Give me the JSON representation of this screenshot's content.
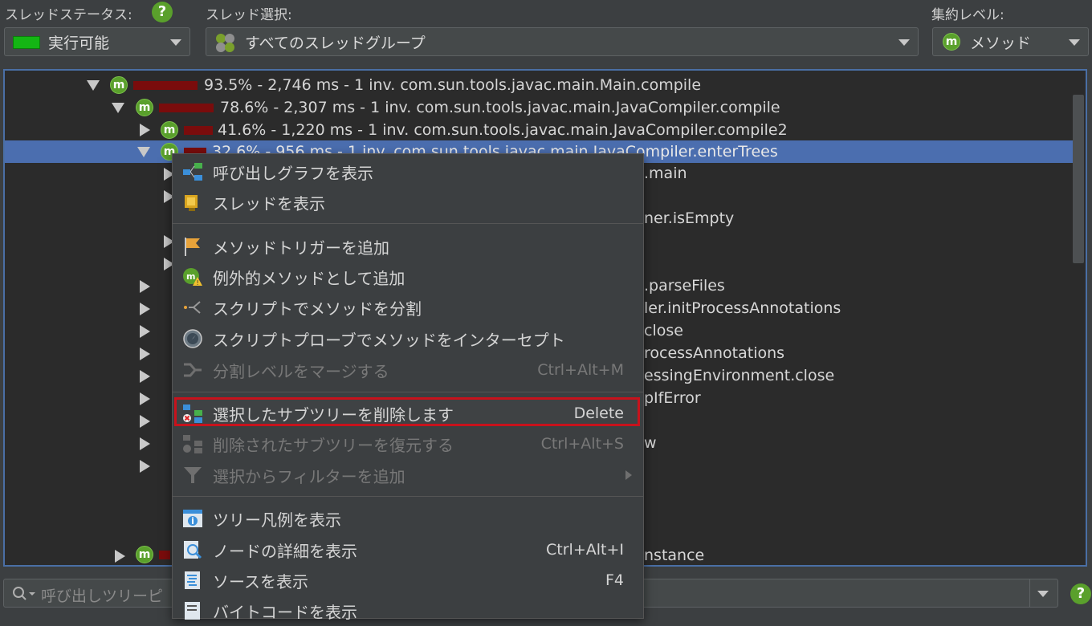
{
  "toolbar": {
    "thread_status_label": "スレッドステータス:",
    "thread_status_value": "実行可能",
    "thread_select_label": "スレッド選択:",
    "thread_select_value": "すべてのスレッドグループ",
    "aggregation_label": "集約レベル:",
    "aggregation_value": "メソッド",
    "help": "?",
    "status_color": "#14b514"
  },
  "tree": {
    "rows": [
      {
        "text": "93.5% - 2,746 ms - 1 inv. com.sun.tools.javac.main.Main.compile"
      },
      {
        "text": "78.6% - 2,307 ms - 1 inv. com.sun.tools.javac.main.JavaCompiler.compile"
      },
      {
        "text": "41.6% - 1,220 ms - 1 inv. com.sun.tools.javac.main.JavaCompiler.compile2"
      },
      {
        "text": "32.6% - 956 ms - 1 inv. com.sun.tools.javac.main.JavaCompiler.enterTrees"
      }
    ],
    "partial": [
      ".main",
      "ner.isEmpty",
      ".parseFiles",
      "ler.initProcessAnnotations",
      "close",
      "rocessAnnotations",
      "essingEnvironment.close",
      "pIfError",
      "w",
      "nstance"
    ],
    "m_label": "m"
  },
  "menu": {
    "items": [
      {
        "label": "呼び出しグラフを表示",
        "shortcut": ""
      },
      {
        "label": "スレッドを表示",
        "shortcut": ""
      },
      {
        "label": "メソッドトリガーを追加",
        "shortcut": ""
      },
      {
        "label": "例外的メソッドとして追加",
        "shortcut": ""
      },
      {
        "label": "スクリプトでメソッドを分割",
        "shortcut": ""
      },
      {
        "label": "スクリプトプローブでメソッドをインターセプト",
        "shortcut": ""
      },
      {
        "label": "分割レベルをマージする",
        "shortcut": "Ctrl+Alt+M"
      },
      {
        "label": "選択したサブツリーを削除します",
        "shortcut": "Delete"
      },
      {
        "label": "削除されたサブツリーを復元する",
        "shortcut": "Ctrl+Alt+S"
      },
      {
        "label": "選択からフィルターを追加",
        "shortcut": ""
      },
      {
        "label": "ツリー凡例を表示",
        "shortcut": ""
      },
      {
        "label": "ノードの詳細を表示",
        "shortcut": "Ctrl+Alt+I"
      },
      {
        "label": "ソースを表示",
        "shortcut": "F4"
      },
      {
        "label": "バイトコードを表示",
        "shortcut": ""
      }
    ]
  },
  "search": {
    "placeholder": "呼び出しツリーピ"
  }
}
